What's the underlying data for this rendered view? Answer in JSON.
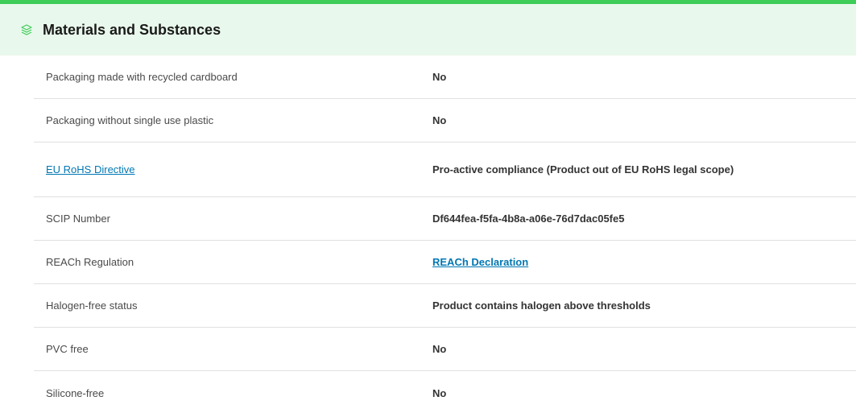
{
  "section": {
    "title": "Materials and Substances",
    "icon": "layers-icon",
    "accent_color": "#3dcd58",
    "header_bg": "#e9f8ec",
    "link_color": "#0077b3"
  },
  "rows": [
    {
      "label": "Packaging made with recycled cardboard",
      "value": "No",
      "label_is_link": false,
      "value_is_link": false
    },
    {
      "label": "Packaging without single use plastic",
      "value": "No",
      "label_is_link": false,
      "value_is_link": false
    },
    {
      "label": "EU RoHS Directive",
      "value": "Pro-active compliance (Product out of EU RoHS legal scope)",
      "label_is_link": true,
      "value_is_link": false
    },
    {
      "label": "SCIP Number",
      "value": "Df644fea-f5fa-4b8a-a06e-76d7dac05fe5",
      "label_is_link": false,
      "value_is_link": false
    },
    {
      "label": "REACh Regulation",
      "value": "REACh Declaration",
      "label_is_link": false,
      "value_is_link": true
    },
    {
      "label": "Halogen-free status",
      "value": "Product contains halogen above thresholds",
      "label_is_link": false,
      "value_is_link": false
    },
    {
      "label": "PVC free",
      "value": "No",
      "label_is_link": false,
      "value_is_link": false
    },
    {
      "label": "Silicone-free",
      "value": "No",
      "label_is_link": false,
      "value_is_link": false
    }
  ]
}
